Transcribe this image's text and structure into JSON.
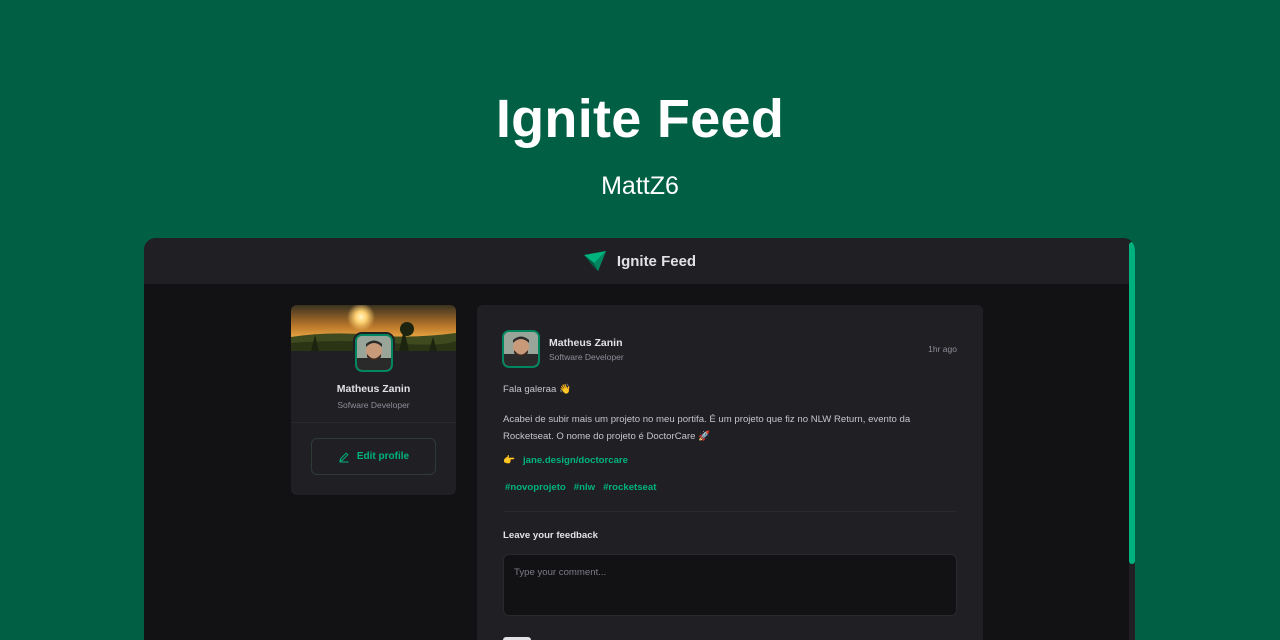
{
  "banner": {
    "title": "Ignite Feed",
    "subtitle": "MattZ6"
  },
  "app": {
    "header_title": "Ignite Feed",
    "logo_icon": "ignite-logo-icon"
  },
  "sidebar": {
    "name": "Matheus Zanin",
    "role": "Sofware Developer",
    "edit_label": "Edit profile",
    "edit_icon": "pencil-icon"
  },
  "post": {
    "author_name": "Matheus Zanin",
    "author_role": "Software Developer",
    "time": "1hr ago",
    "greeting": "Fala galeraa 👋",
    "body": "Acabei de subir mais um projeto no meu portifa. É um projeto que fiz no NLW Return, evento da Rocketseat. O nome do projeto é DoctorCare 🚀",
    "link_emoji": "👉",
    "link_text": "jane.design/doctorcare",
    "tags": [
      "#novoprojeto",
      "#nlw",
      "#rocketseat"
    ]
  },
  "feedback": {
    "title": "Leave your feedback",
    "placeholder": "Type your comment..."
  },
  "colors": {
    "brand_bg": "#015f43",
    "accent": "#00b37e",
    "surface": "#202024",
    "background": "#121214"
  }
}
